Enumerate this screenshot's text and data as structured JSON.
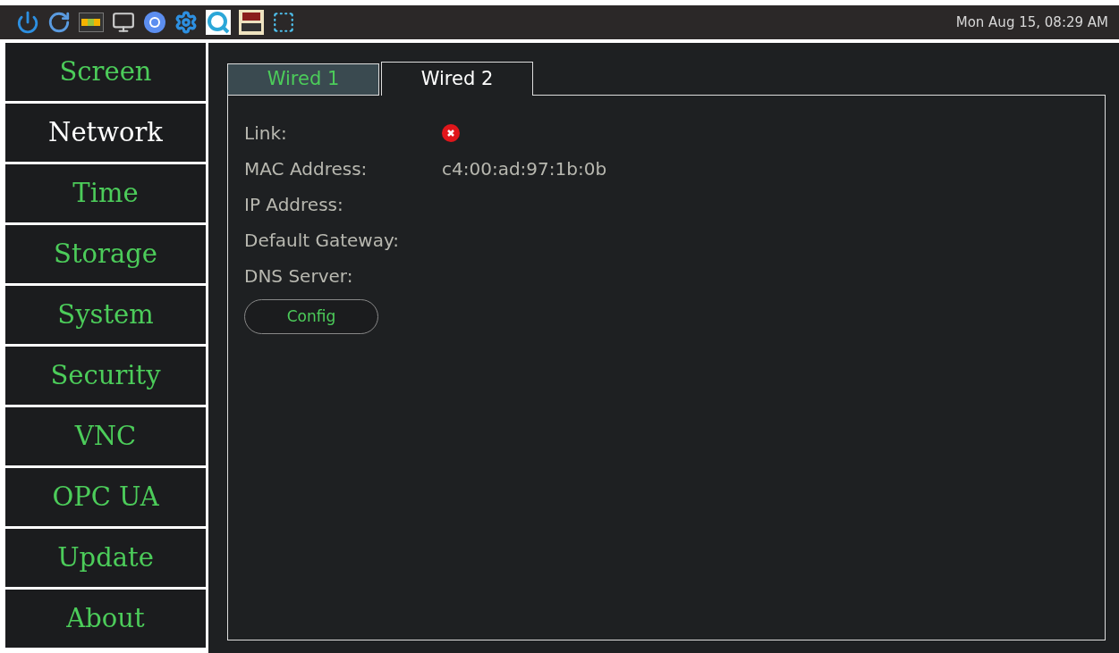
{
  "taskbar": {
    "clock": "Mon Aug 15, 08:29 AM"
  },
  "sidebar": {
    "items": [
      {
        "label": "Screen",
        "selected": false
      },
      {
        "label": "Network",
        "selected": true
      },
      {
        "label": "Time",
        "selected": false
      },
      {
        "label": "Storage",
        "selected": false
      },
      {
        "label": "System",
        "selected": false
      },
      {
        "label": "Security",
        "selected": false
      },
      {
        "label": "VNC",
        "selected": false
      },
      {
        "label": "OPC UA",
        "selected": false
      },
      {
        "label": "Update",
        "selected": false
      },
      {
        "label": "About",
        "selected": false
      }
    ]
  },
  "tabs": [
    {
      "label": "Wired 1",
      "selected": false
    },
    {
      "label": "Wired 2",
      "selected": true
    }
  ],
  "fields": [
    {
      "label": "Link:",
      "kind": "status",
      "connected": false
    },
    {
      "label": "MAC Address:",
      "kind": "text",
      "value": "c4:00:ad:97:1b:0b"
    },
    {
      "label": "IP Address:",
      "kind": "text"
    },
    {
      "label": "Default Gateway:",
      "kind": "text"
    },
    {
      "label": "DNS Server:",
      "kind": "text"
    }
  ],
  "config_button": "Config"
}
